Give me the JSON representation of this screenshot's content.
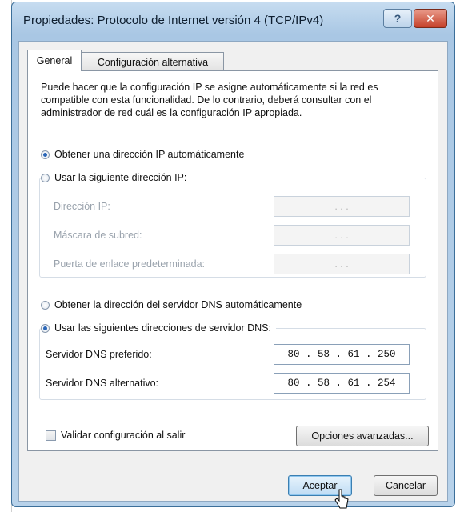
{
  "window": {
    "title": "Propiedades: Protocolo de Internet versión 4 (TCP/IPv4)",
    "help_label": "?",
    "close_label": "✕"
  },
  "tabs": [
    {
      "label": "General",
      "active": true
    },
    {
      "label": "Configuración alternativa",
      "active": false
    }
  ],
  "general": {
    "description": "Puede hacer que la configuración IP se asigne automáticamente si la red es compatible con esta funcionalidad. De lo contrario, deberá consultar con el administrador de red cuál es la configuración IP apropiada.",
    "ip_auto_label": "Obtener una dirección IP automáticamente",
    "ip_auto_selected": true,
    "ip_manual_label": "Usar la siguiente dirección IP:",
    "ip_manual_selected": false,
    "ip_fields": [
      {
        "label": "Dirección IP:",
        "value": ". . ."
      },
      {
        "label": "Máscara de subred:",
        "value": ". . ."
      },
      {
        "label": "Puerta de enlace predeterminada:",
        "value": ". . ."
      }
    ],
    "dns_auto_label": "Obtener la dirección del servidor DNS automáticamente",
    "dns_auto_selected": false,
    "dns_manual_label": "Usar las siguientes direcciones de servidor DNS:",
    "dns_manual_selected": true,
    "dns_fields": [
      {
        "label": "Servidor DNS preferido:",
        "value": "80 . 58 . 61 . 250"
      },
      {
        "label": "Servidor DNS alternativo:",
        "value": "80 . 58 . 61 . 254"
      }
    ],
    "validate_label": "Validar configuración al salir",
    "validate_checked": false,
    "advanced_label": "Opciones avanzadas..."
  },
  "footer": {
    "ok_label": "Aceptar",
    "cancel_label": "Cancelar"
  },
  "colors": {
    "titlebar": "#a9c7e4",
    "close_button": "#c5412a",
    "radio_selected": "#2a66b8"
  }
}
